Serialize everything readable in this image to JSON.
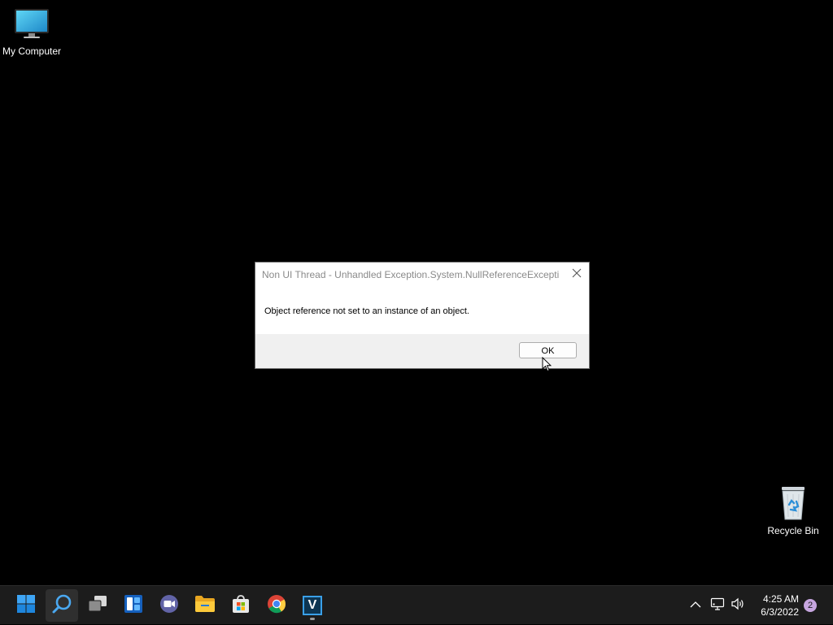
{
  "desktop": {
    "icons": [
      {
        "label": "My Computer",
        "icon": "monitor-icon"
      },
      {
        "label": "Recycle Bin",
        "icon": "recycle-bin-icon"
      }
    ]
  },
  "dialog": {
    "title": "Non UI Thread - Unhandled Exception.System.NullReferenceExcepti...",
    "message": "Object reference not set to an instance of an object.",
    "ok_label": "OK",
    "close_icon": "close-icon"
  },
  "taskbar": {
    "apps": [
      {
        "name": "start",
        "icon": "windows-logo-icon"
      },
      {
        "name": "search",
        "icon": "search-icon",
        "active": true
      },
      {
        "name": "task-view",
        "icon": "task-view-icon"
      },
      {
        "name": "widgets",
        "icon": "widgets-icon"
      },
      {
        "name": "chat",
        "icon": "chat-icon"
      },
      {
        "name": "file-explorer",
        "icon": "folder-icon"
      },
      {
        "name": "store",
        "icon": "store-icon"
      },
      {
        "name": "chrome",
        "icon": "chrome-icon"
      },
      {
        "name": "app-v",
        "icon": "v-app-icon",
        "label": "V",
        "running": true
      }
    ],
    "tray": {
      "chevron_icon": "chevron-up-icon",
      "network_icon": "network-icon",
      "volume_icon": "volume-icon",
      "time": "4:25 AM",
      "date": "6/3/2022",
      "notification_count": "2"
    }
  },
  "colors": {
    "desktop_bg": "#000000",
    "taskbar_bg": "#1c1c1c",
    "badge": "#c7a6e0",
    "accent_blue": "#0078d4"
  }
}
